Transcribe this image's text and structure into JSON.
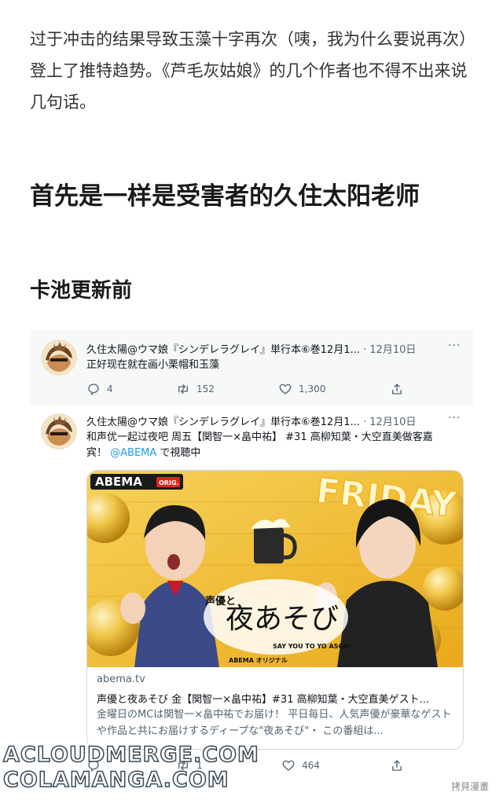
{
  "article": {
    "intro": "过于冲击的结果导致玉藻十字再次（咦，我为什么要说再次）登上了推特趋势。《芦毛灰姑娘》的几个作者也不得不出来说几句话。",
    "heading": "首先是一样是受害者的久住太阳老师",
    "subheading": "卡池更新前"
  },
  "tweets": [
    {
      "author": "久住太陽@ウマ娘『シンデレラグレイ』単行本⑥巻12月1...",
      "date": "· 12月10日",
      "more": "···",
      "text": "正好现在就在画小栗帽和玉藻",
      "replies": "4",
      "retweets": "152",
      "likes": "1,300"
    },
    {
      "author": "久住太陽@ウマ娘『シンデレラグレイ』単行本⑥巻12月1...",
      "date": "· 12月10日",
      "more": "···",
      "text_line1": "和声优一起过夜吧 周五【関智一×畠中祐】 #31 高柳知葉・大空直美做客嘉",
      "text_line2_pre": "宾！ ",
      "mention": "@ABEMA",
      "text_line2_post": " で視聴中",
      "card": {
        "domain": "abema.tv",
        "title": "声優と夜あそび 金【関智一×畠中祐】#31 高柳知葉・大空直美ゲスト...",
        "description": "金曜日のMCは関智一×畠中祐でお届け！ 平日毎日、人気声優が豪華なゲストや作品と共にお届けするディープな\"夜あそび\"・ この番組は...",
        "image": {
          "logo": "ABEMA",
          "logo_tag": "ORIG.",
          "banner": "FRIDAY",
          "show_title_main": "夜あそび",
          "show_title_small": "声優と",
          "show_subtitle": "SAY YOU TO YO ASOBI",
          "footer_logo": "ABEMA オリジナル"
        }
      },
      "retweets": "1",
      "likes": "464"
    }
  ],
  "watermark": {
    "line1": "ACLOUDMERGE.COM",
    "line2": "COLAMANGA.COM",
    "corner": "拷貝漫畫"
  },
  "colors": {
    "link": "#1d9bf0",
    "muted": "#536471",
    "gold": "#f2b928",
    "abema_green": "#2ab96b"
  }
}
